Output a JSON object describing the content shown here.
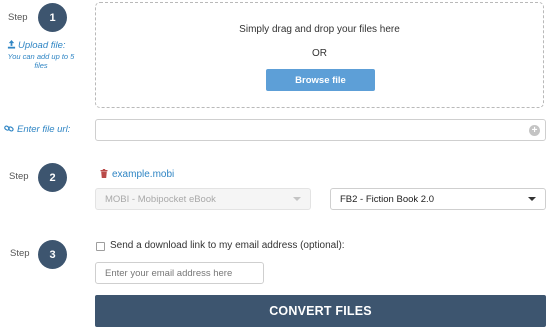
{
  "steps": {
    "step_label": "Step",
    "step1_number": "1",
    "step2_number": "2",
    "step3_number": "3"
  },
  "upload": {
    "link_label": "Upload file:",
    "note": "You can add up to 5 files",
    "drop_text": "Simply drag and drop your files here",
    "or_text": "OR",
    "browse_button": "Browse file"
  },
  "url": {
    "link_label": "Enter file url:",
    "value": "",
    "add_icon": "plus-circle-icon"
  },
  "conversion": {
    "file_name": "example.mobi",
    "source_format": "MOBI - Mobipocket eBook",
    "target_format": "FB2 - Fiction Book 2.0"
  },
  "email": {
    "checkbox_label": "Send a download link to my email address (optional):",
    "checked": false,
    "placeholder": "Enter your email address here"
  },
  "convert_button": "CONVERT FILES",
  "colors": {
    "step_circle": "#3d556f",
    "link": "#2f85c4",
    "browse_button": "#5d9fd7",
    "convert_button": "#3d556f",
    "trash_icon": "#b94a48"
  }
}
